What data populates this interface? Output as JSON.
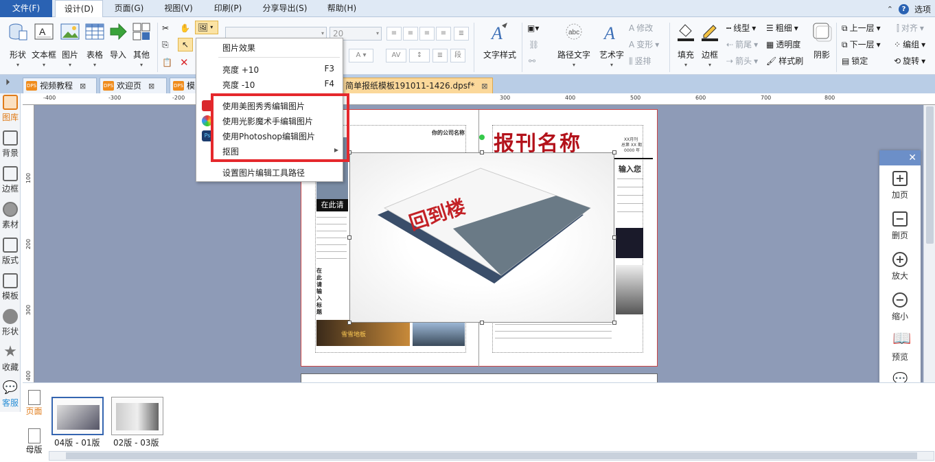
{
  "menubar": {
    "file": "文件(F)",
    "design": "设计(D)",
    "page": "页面(G)",
    "view": "视图(V)",
    "print": "印刷(P)",
    "share": "分享导出(S)",
    "help": "帮助(H)",
    "options": "选项"
  },
  "ribbon": {
    "shape": "形状",
    "textbox": "文本框",
    "picture": "图片",
    "table": "表格",
    "import": "导入",
    "other": "其他",
    "font_size": "20",
    "text_style": "文字样式",
    "path_text": "路径文字",
    "art_text": "艺术字",
    "modify": "修改",
    "transform": "变形",
    "vertical": "竖排",
    "fill": "填充",
    "border": "边框",
    "line_type": "线型",
    "bold": "粗细",
    "arrow_tail": "箭尾",
    "arrow_head": "箭头",
    "transparency": "透明度",
    "format_brush": "样式刷",
    "shadow": "阴影",
    "up_layer": "上一层",
    "down_layer": "下一层",
    "lock": "锁定",
    "align": "对齐",
    "group": "编组",
    "rotate": "旋转"
  },
  "tabs": [
    {
      "label": "视频教程"
    },
    {
      "label": "欢迎页"
    },
    {
      "label": "模"
    },
    {
      "label": "简单报纸模板191011-1426.dpsf*"
    }
  ],
  "dropdown": {
    "effects": "图片效果",
    "brightness_up": "亮度 +10",
    "brightness_up_key": "F3",
    "brightness_down": "亮度 -10",
    "brightness_down_key": "F4",
    "meitu": "使用美图秀秀编辑图片",
    "guangying": "使用光影魔术手编辑图片",
    "photoshop": "使用Photoshop编辑图片",
    "cutout": "抠图",
    "set_path": "设置图片编辑工具路径"
  },
  "sidebar": {
    "library": "图库",
    "background": "背景",
    "border": "边框",
    "material": "素材",
    "layout": "版式",
    "template": "模板",
    "shape": "形状",
    "favorite": "收藏",
    "service": "客服"
  },
  "ruler": {
    "top": [
      "-400",
      "-300",
      "-200",
      "300",
      "400",
      "500",
      "600",
      "700",
      "800"
    ],
    "left": [
      "100",
      "200",
      "300",
      "400"
    ]
  },
  "document": {
    "company": "你的公司名称",
    "masthead": "报刊名称",
    "issue_line1": "XX月刊",
    "issue_line2": "总第 XX 期",
    "issue_line3": "0000 年",
    "enter_here": "在此请",
    "enter_vertical": "在此请输入标题",
    "input_right": "输入您",
    "caption": "雪雪地板"
  },
  "right_panel": {
    "add_page": "加页",
    "delete_page": "删页",
    "zoom_in": "放大",
    "zoom_out": "缩小",
    "preview": "预览",
    "share": "分享"
  },
  "bottom": {
    "page_tab": "页面",
    "master_tab": "母版",
    "thumb1": "04版 - 01版",
    "thumb2": "02版 - 03版"
  },
  "colors": {
    "accent": "#2a62b3",
    "highlight": "#e5282c",
    "masthead": "#b3121b"
  }
}
